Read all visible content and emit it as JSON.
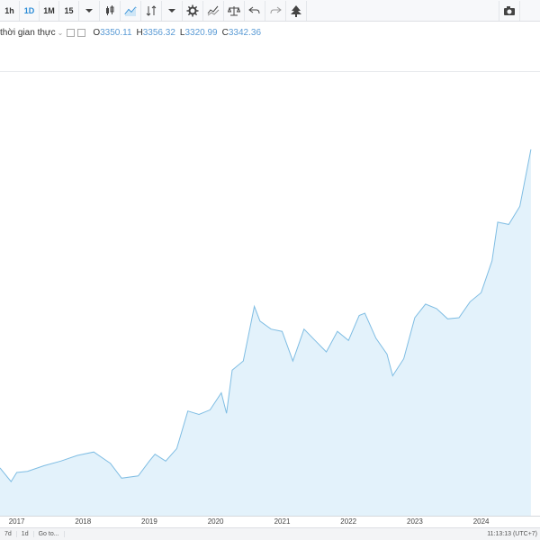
{
  "toolbar": {
    "intervals": [
      "1h",
      "1D",
      "1M",
      "15"
    ],
    "active_interval": "1D",
    "icons": [
      "chevron-down-icon",
      "candles-icon",
      "line-chart-icon",
      "indicator-icon",
      "chevron-down-icon",
      "settings-gear-icon",
      "compare-icon",
      "scale-icon",
      "undo-icon",
      "redo-icon",
      "tree-icon",
      "camera-icon"
    ]
  },
  "legend": {
    "symbol": "thời gian thực",
    "caret": "⌄",
    "open_label": "O",
    "open": "3350.11",
    "high_label": "H",
    "high": "3356.32",
    "low_label": "L",
    "low": "3320.99",
    "close_label": "C",
    "close": "3342.36"
  },
  "chart_data": {
    "type": "area",
    "line_color": "#7fbde3",
    "fill_color": "#e3f2fb",
    "x": [
      "2016-10",
      "2016-12",
      "2017-01",
      "2017-03",
      "2017-06",
      "2017-09",
      "2017-12",
      "2018-03",
      "2018-06",
      "2018-08",
      "2018-11",
      "2019-01",
      "2019-02",
      "2019-04",
      "2019-06",
      "2019-08",
      "2019-10",
      "2019-12",
      "2020-02",
      "2020-03",
      "2020-04",
      "2020-06",
      "2020-08",
      "2020-09",
      "2020-11",
      "2021-01",
      "2021-03",
      "2021-05",
      "2021-07",
      "2021-09",
      "2021-11",
      "2022-01",
      "2022-03",
      "2022-04",
      "2022-06",
      "2022-08",
      "2022-09",
      "2022-11",
      "2023-01",
      "2023-03",
      "2023-05",
      "2023-07",
      "2023-09",
      "2023-11",
      "2024-01",
      "2024-03",
      "2024-04",
      "2024-06",
      "2024-08",
      "2024-10"
    ],
    "y": [
      1260,
      1200,
      1240,
      1245,
      1270,
      1290,
      1315,
      1330,
      1280,
      1215,
      1225,
      1290,
      1320,
      1290,
      1345,
      1510,
      1495,
      1515,
      1590,
      1500,
      1690,
      1730,
      1970,
      1905,
      1870,
      1860,
      1730,
      1870,
      1820,
      1770,
      1860,
      1820,
      1930,
      1940,
      1830,
      1760,
      1665,
      1740,
      1920,
      1980,
      1960,
      1915,
      1920,
      1990,
      2030,
      2170,
      2340,
      2330,
      2410,
      2660
    ]
  },
  "xaxis": {
    "labels": [
      "2017",
      "2018",
      "2019",
      "2020",
      "2021",
      "2022",
      "2023",
      "2024"
    ]
  },
  "bottombar": {
    "range_partial": "7d",
    "range": "1d",
    "goto": "Go to...",
    "time": "11:13:13 (UTC+7)"
  }
}
